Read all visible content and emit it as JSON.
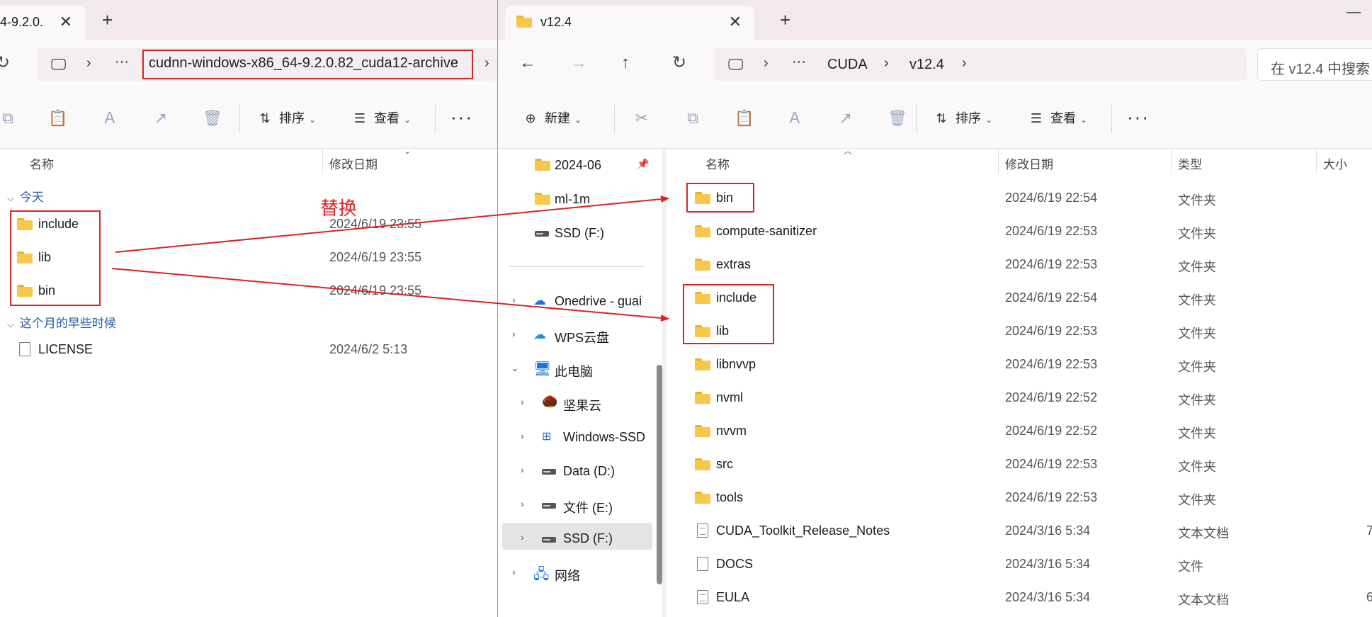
{
  "left_window": {
    "tab": {
      "title": "4-9.2.0."
    },
    "address": {
      "path": "cudnn-windows-x86_64-9.2.0.82_cuda12-archive"
    },
    "toolbar": {
      "sort_label": "排序",
      "view_label": "查看"
    },
    "columns": {
      "name": "名称",
      "modified": "修改日期"
    },
    "groups": [
      {
        "label": "今天",
        "items": [
          {
            "name": "include",
            "date": "2024/6/19 23:55"
          },
          {
            "name": "lib",
            "date": "2024/6/19 23:55"
          },
          {
            "name": "bin",
            "date": "2024/6/19 23:55"
          }
        ]
      },
      {
        "label": "这个月的早些时候",
        "items": [
          {
            "name": "LICENSE",
            "date": "2024/6/2 5:13"
          }
        ]
      }
    ]
  },
  "annotation": {
    "text": "替换",
    "color": "#e02020"
  },
  "right_window": {
    "tab": {
      "title": "v12.4"
    },
    "breadcrumb": [
      "CUDA",
      "v12.4"
    ],
    "search": {
      "placeholder": "在 v12.4 中搜索"
    },
    "toolbar": {
      "new_label": "新建",
      "sort_label": "排序",
      "view_label": "查看"
    },
    "columns": {
      "name": "名称",
      "modified": "修改日期",
      "type": "类型",
      "size": "大小"
    },
    "nav": [
      {
        "label": "2024-06"
      },
      {
        "label": "ml-1m"
      },
      {
        "label": "SSD (F:)"
      },
      {
        "label": "Onedrive - guai"
      },
      {
        "label": "WPS云盘"
      },
      {
        "label": "此电脑"
      },
      {
        "label": "坚果云"
      },
      {
        "label": "Windows-SSD"
      },
      {
        "label": "Data (D:)"
      },
      {
        "label": "文件 (E:)"
      },
      {
        "label": "SSD (F:)"
      },
      {
        "label": "网络"
      }
    ],
    "files": [
      {
        "name": "bin",
        "date": "2024/6/19 22:54",
        "type": "文件夹",
        "size": ""
      },
      {
        "name": "compute-sanitizer",
        "date": "2024/6/19 22:53",
        "type": "文件夹",
        "size": ""
      },
      {
        "name": "extras",
        "date": "2024/6/19 22:53",
        "type": "文件夹",
        "size": ""
      },
      {
        "name": "include",
        "date": "2024/6/19 22:54",
        "type": "文件夹",
        "size": ""
      },
      {
        "name": "lib",
        "date": "2024/6/19 22:53",
        "type": "文件夹",
        "size": ""
      },
      {
        "name": "libnvvp",
        "date": "2024/6/19 22:53",
        "type": "文件夹",
        "size": ""
      },
      {
        "name": "nvml",
        "date": "2024/6/19 22:52",
        "type": "文件夹",
        "size": ""
      },
      {
        "name": "nvvm",
        "date": "2024/6/19 22:52",
        "type": "文件夹",
        "size": ""
      },
      {
        "name": "src",
        "date": "2024/6/19 22:53",
        "type": "文件夹",
        "size": ""
      },
      {
        "name": "tools",
        "date": "2024/6/19 22:53",
        "type": "文件夹",
        "size": ""
      },
      {
        "name": "CUDA_Toolkit_Release_Notes",
        "date": "2024/3/16 5:34",
        "type": "文本文档",
        "size": "7"
      },
      {
        "name": "DOCS",
        "date": "2024/3/16 5:34",
        "type": "文件",
        "size": ""
      },
      {
        "name": "EULA",
        "date": "2024/3/16 5:34",
        "type": "文本文档",
        "size": "6"
      }
    ]
  }
}
